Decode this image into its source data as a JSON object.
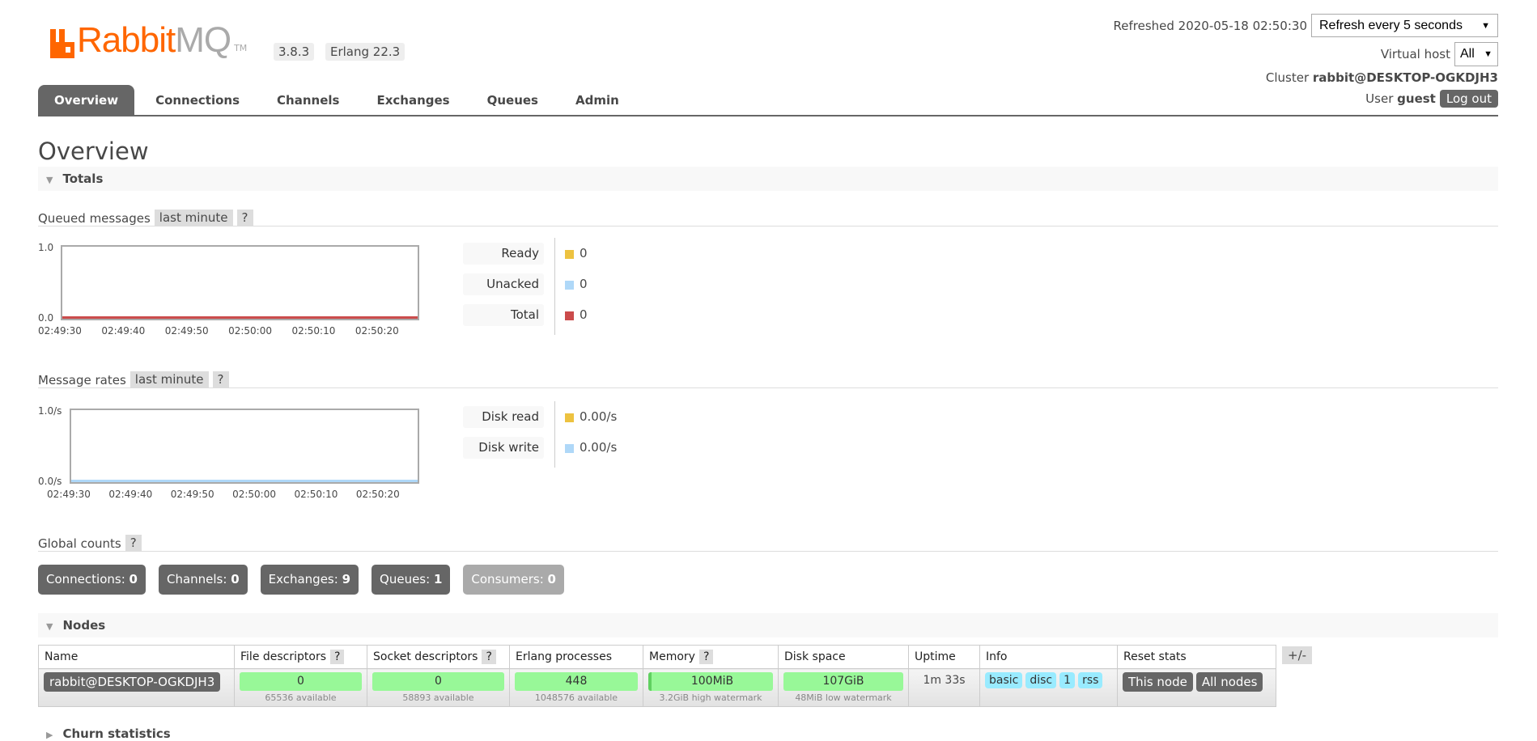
{
  "header": {
    "logo_text": "RabbitMQ",
    "logo_tm": "TM",
    "version": "3.8.3",
    "erlang": "Erlang 22.3",
    "refreshed": "Refreshed 2020-05-18 02:50:30",
    "refresh_select": "Refresh every 5 seconds",
    "vhost_label": "Virtual host",
    "vhost_select": "All",
    "cluster_label": "Cluster",
    "cluster_name": "rabbit@DESKTOP-OGKDJH3",
    "user_label": "User",
    "user_name": "guest",
    "logout": "Log out"
  },
  "tabs": [
    {
      "label": "Overview",
      "active": true
    },
    {
      "label": "Connections"
    },
    {
      "label": "Channels"
    },
    {
      "label": "Exchanges"
    },
    {
      "label": "Queues"
    },
    {
      "label": "Admin"
    }
  ],
  "page_title": "Overview",
  "totals": {
    "title": "Totals",
    "queued": {
      "label": "Queued messages",
      "range": "last minute",
      "help": "?"
    },
    "rates": {
      "label": "Message rates",
      "range": "last minute",
      "help": "?"
    },
    "global": {
      "label": "Global counts",
      "help": "?"
    }
  },
  "chart_data": [
    {
      "type": "line",
      "ylim": [
        0,
        1
      ],
      "yticks": [
        "1.0",
        "0.0"
      ],
      "xticks": [
        "02:49:30",
        "02:49:40",
        "02:49:50",
        "02:50:00",
        "02:50:10",
        "02:50:20"
      ],
      "series": [
        {
          "name": "Ready",
          "color": "#edc240",
          "value": "0"
        },
        {
          "name": "Unacked",
          "color": "#afd8f8",
          "value": "0"
        },
        {
          "name": "Total",
          "color": "#cb4b4b",
          "value": "0"
        }
      ]
    },
    {
      "type": "line",
      "ylim": [
        0,
        1
      ],
      "yticks": [
        "1.0/s",
        "0.0/s"
      ],
      "xticks": [
        "02:49:30",
        "02:49:40",
        "02:49:50",
        "02:50:00",
        "02:50:10",
        "02:50:20"
      ],
      "series": [
        {
          "name": "Disk read",
          "color": "#edc240",
          "value": "0.00/s"
        },
        {
          "name": "Disk write",
          "color": "#afd8f8",
          "value": "0.00/s"
        }
      ]
    }
  ],
  "counts": [
    {
      "label": "Connections:",
      "value": "0"
    },
    {
      "label": "Channels:",
      "value": "0"
    },
    {
      "label": "Exchanges:",
      "value": "9"
    },
    {
      "label": "Queues:",
      "value": "1"
    },
    {
      "label": "Consumers:",
      "value": "0",
      "disabled": true
    }
  ],
  "nodes": {
    "title": "Nodes",
    "plusminus": "+/-",
    "headers": [
      "Name",
      "File descriptors",
      "Socket descriptors",
      "Erlang processes",
      "Memory",
      "Disk space",
      "Uptime",
      "Info",
      "Reset stats"
    ],
    "help": "?",
    "row": {
      "name": "rabbit@DESKTOP-OGKDJH3",
      "fd": "0",
      "fd_sub": "65536 available",
      "sd": "0",
      "sd_sub": "58893 available",
      "ep": "448",
      "ep_sub": "1048576 available",
      "mem": "100MiB",
      "mem_sub": "3.2GiB high watermark",
      "disk": "107GiB",
      "disk_sub": "48MiB low watermark",
      "uptime": "1m 33s",
      "info": [
        "basic",
        "disc",
        "1",
        "rss"
      ],
      "this_node": "This node",
      "all_nodes": "All nodes"
    }
  },
  "churn": {
    "title": "Churn statistics"
  }
}
